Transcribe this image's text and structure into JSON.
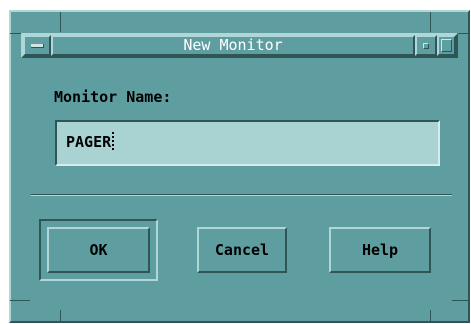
{
  "window": {
    "title": "New Monitor"
  },
  "form": {
    "label": "Monitor Name:",
    "value": "PAGER"
  },
  "buttons": {
    "ok": "OK",
    "cancel": "Cancel",
    "help": "Help"
  },
  "icons": {
    "window_menu": "window-menu-icon",
    "minimize": "minimize-icon",
    "maximize": "maximize-icon",
    "caret": "text-cursor-icon"
  },
  "colors": {
    "background": "#5f9ea0",
    "highlight": "#b0d6d8",
    "shadow": "#2f5557",
    "field": "#a9d2d3"
  }
}
